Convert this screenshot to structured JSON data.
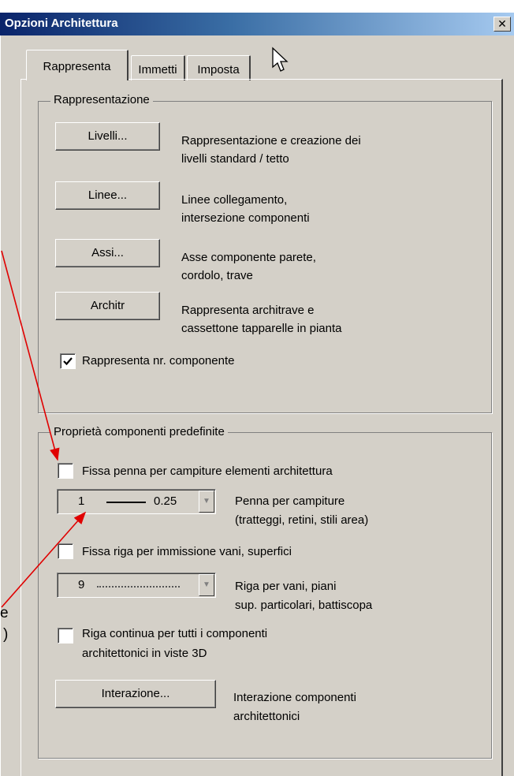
{
  "window": {
    "title": "Opzioni Architettura",
    "close_glyph": "✕"
  },
  "tabs": [
    {
      "label": "Rappresenta",
      "active": true
    },
    {
      "label": "Immetti",
      "active": false
    },
    {
      "label": "Imposta",
      "active": false
    }
  ],
  "rappresentazione": {
    "legend": "Rappresentazione",
    "rows": [
      {
        "button": "Livelli...",
        "desc1": "Rappresentazione e creazione dei",
        "desc2": "livelli standard / tetto"
      },
      {
        "button": "Linee...",
        "desc1": "Linee collegamento,",
        "desc2": "intersezione componenti"
      },
      {
        "button": "Assi...",
        "desc1": "Asse componente parete,",
        "desc2": "cordolo, trave"
      },
      {
        "button": "Architr",
        "desc1": "Rappresenta architrave e",
        "desc2": "cassettone tapparelle in pianta"
      }
    ],
    "checkbox_label": "Rappresenta nr. componente",
    "checkbox_checked": true
  },
  "proprieta": {
    "legend": "Proprietà componenti predefinite",
    "fissa_penna": {
      "label": "Fissa penna per campiture elementi architettura",
      "checked": false
    },
    "penna_combo": {
      "value": "1",
      "width": "0.25",
      "desc1": "Penna per campiture",
      "desc2": "(tratteggi, retini, stili area)"
    },
    "fissa_riga": {
      "label": "Fissa riga per immissione vani, superfici",
      "checked": false
    },
    "riga_combo": {
      "value": "9",
      "desc1": "Riga per vani, piani",
      "desc2": "sup. particolari, battiscopa"
    },
    "riga_continua": {
      "label1": "Riga continua per tutti i componenti",
      "label2": "architettonici in viste 3D",
      "checked": false
    },
    "interazione": {
      "button": "Interazione...",
      "desc1": "Interazione componenti",
      "desc2": "architettonici"
    }
  },
  "annotations": {
    "fragment1": "e",
    "fragment2": ")",
    "arrow_color": "#e00000"
  },
  "icons": {
    "cursor": "mouse-pointer-icon",
    "check": "checkmark-icon",
    "dropdown": "chevron-down-icon"
  }
}
